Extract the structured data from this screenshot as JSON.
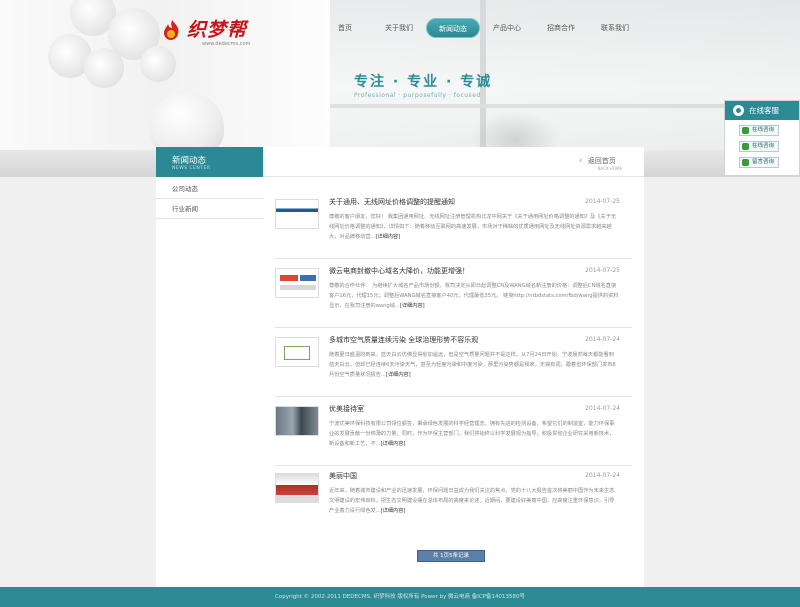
{
  "header": {
    "logo_text": "织梦帮",
    "logo_sub": "www.dedecms.com",
    "nav": [
      "首页",
      "关于我们",
      "新闻动态",
      "产品中心",
      "招商合作",
      "联系我们"
    ],
    "active_nav": 2,
    "slogan": "专注 · 专业 · 专诚",
    "slogan_en": "Professional · purposefully · focused"
  },
  "service": {
    "title": "在线客服",
    "buttons": [
      "在线咨询",
      "在线咨询",
      "留言咨询"
    ]
  },
  "sidebar": {
    "title": "新闻动态",
    "title_en": "NEWS CENTER",
    "items": [
      "公司动态",
      "行业新闻"
    ]
  },
  "content": {
    "back_label": "返回首页",
    "back_en": "BACK HOME",
    "more_label": "[详细内容]",
    "news": [
      {
        "title": "关于通用、无线网址价格调整的提醒通知",
        "date": "2014-07-25",
        "desc": "尊敬的客户朋友，您好！ 我集团通用网址、无线网址注册管理机构北龙中网关于《关于通用网址价格调整的通知》及《关于无线网址价格调整的通知》，详情如下：随着移动互联网的高速发展，市场对于稀缺的优质通用网址及无线网址资源需求越来越大，对品牌移动营..."
      },
      {
        "title": "微云电商封撤中心域名大降价，功能更增强！",
        "date": "2014-07-25",
        "desc": "尊敬的合作伙伴： 为继续扩大域名产品市场份额，我司决定从即日起调整CN及WANG域名新注册的价格：调整后CN域名直接客户16元，代理15元；调整后WANG域名直接客户40元，代理最低35元。 链接http://ntbdstats.com/fbd/wang提供的资料显示，在我司注册的wang域..."
      },
      {
        "title": "多城市空气质量连续污染 全球治理形势不容乐观",
        "date": "2014-07-24",
        "desc": "随着夏日盛温的到来，蓝天白云仿佛显得愈加遥远，但是空气质量问题并不是这样，从7月24日开始，宁波晨然每天都能看到蓝天白云，但却已经连续6天污染天气，甚至为轻度污染和中度污染，那里污染势都是我家。无锡有调，跟着省环保部门发布8月份空气质量状况报告..."
      },
      {
        "title": "优美接待室",
        "date": "2014-07-24",
        "desc": "宁波优美环保科技有限公司领位舰签，秉承绿色发展的科学经营理念，拥有先进的检测设备，希望它们的制造室，能力环保事业的发展贡献一份绵薄的力量。同时，作为环保主营部门，我们将始终以科学发展观为指导，积极贯彻企业研究采用新技术，新设备和新工艺，不..."
      },
      {
        "title": "美丽中国",
        "date": "2014-07-24",
        "desc": "近年来，随着城市建设和产业的迅速发展，环保问题日益成为我们关注的焦点，党的十八大报告首次将美丽中国作为未来生态文明建设的宏伟目标，把生态文明建设摆在总体布局的高度来论述。近期间，要建设好美丽中国，应高度注重环保意识，引导产业着力设行绿色发..."
      }
    ],
    "pager": "共 1页5条记录"
  },
  "footer": {
    "text": "Copyright © 2002-2011 DEDECMS. 织梦科技 版权所有 Power by 微云电商 备ICP备14013580号"
  },
  "colors": {
    "accent": "#2b8a93",
    "logo": "#c8151b"
  }
}
